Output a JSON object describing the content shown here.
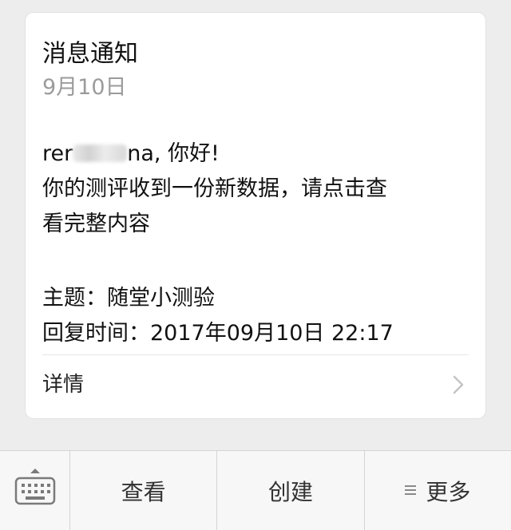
{
  "card": {
    "title": "消息通知",
    "date": "9月10日",
    "greeting_prefix": "rer",
    "greeting_suffix": "na, 你好!",
    "message_line1": "你的测评收到一份新数据，请点击查",
    "message_line2": "看完整内容",
    "topic_line": "主题：随堂小测验",
    "reply_time_line": "回复时间：2017年09月10日 22:17",
    "details_label": "详情"
  },
  "bottom_bar": {
    "keyboard_icon": "keyboard-icon",
    "items": [
      {
        "label": "查看"
      },
      {
        "label": "创建"
      },
      {
        "label": "更多",
        "icon": "menu-lines-icon"
      }
    ]
  },
  "colors": {
    "background": "#ededed",
    "card": "#ffffff",
    "date_text": "#9b9b9b",
    "bar": "#f7f7f7"
  }
}
